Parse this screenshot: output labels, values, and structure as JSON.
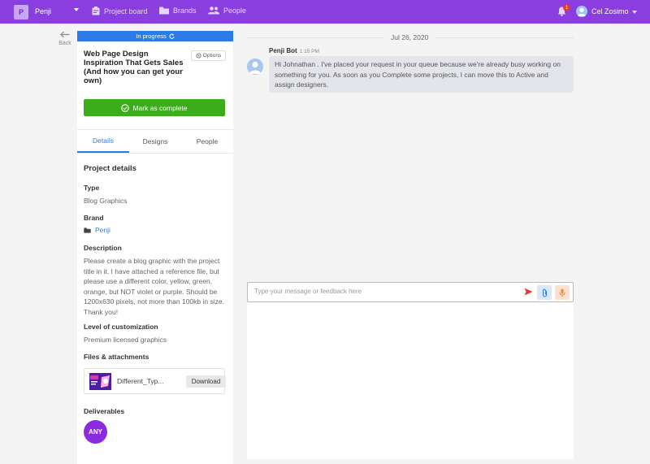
{
  "topbar": {
    "workspace_initial": "P",
    "workspace_name": "Penji",
    "nav": [
      {
        "label": "Project board",
        "icon": "clipboard-icon"
      },
      {
        "label": "Brands",
        "icon": "folder-icon"
      },
      {
        "label": "People",
        "icon": "people-icon"
      }
    ],
    "notification_count": "1",
    "user_name": "Cel Zosimo"
  },
  "back": {
    "label": "Back"
  },
  "project": {
    "status": "In progress",
    "title": "Web Page Design Inspiration That Gets Sales (And how you can get your own)",
    "options_label": "Options",
    "complete_label": "Mark as complete",
    "tabs": [
      "Details",
      "Designs",
      "People"
    ],
    "details_heading": "Project details",
    "type_label": "Type",
    "type_value": "Blog Graphics",
    "brand_label": "Brand",
    "brand_value": "Penji",
    "description_label": "Description",
    "description_value": "Please create a blog graphic with the project title in it. I have attached a reference file, but please use a different color, yellow, green, orange, but NOT violet or purple. Should be 1200x630 pixels, not more than 100kb in size. Thank you!",
    "customization_label": "Level of customization",
    "customization_value": "Premium licensed graphics",
    "files_label": "Files & attachments",
    "file_name": "Different_Typ...",
    "download_label": "Download",
    "deliverables_label": "Deliverables",
    "deliverable_badge": "ANY"
  },
  "chat": {
    "date": "Jul 26, 2020",
    "sender": "Penji Bot",
    "time": "1:15 PM",
    "message": "Hi Johnathan . I've placed your request in your queue because we're already busy working on something for you. As soon as you Complete some projects, I can move this to Active and assign designers.",
    "placeholder": "Type your message or feedback here"
  },
  "colors": {
    "topbar": "#8a3ee0",
    "status": "#2d7be5",
    "complete": "#3cad1a",
    "badge": "#8a2be2"
  }
}
